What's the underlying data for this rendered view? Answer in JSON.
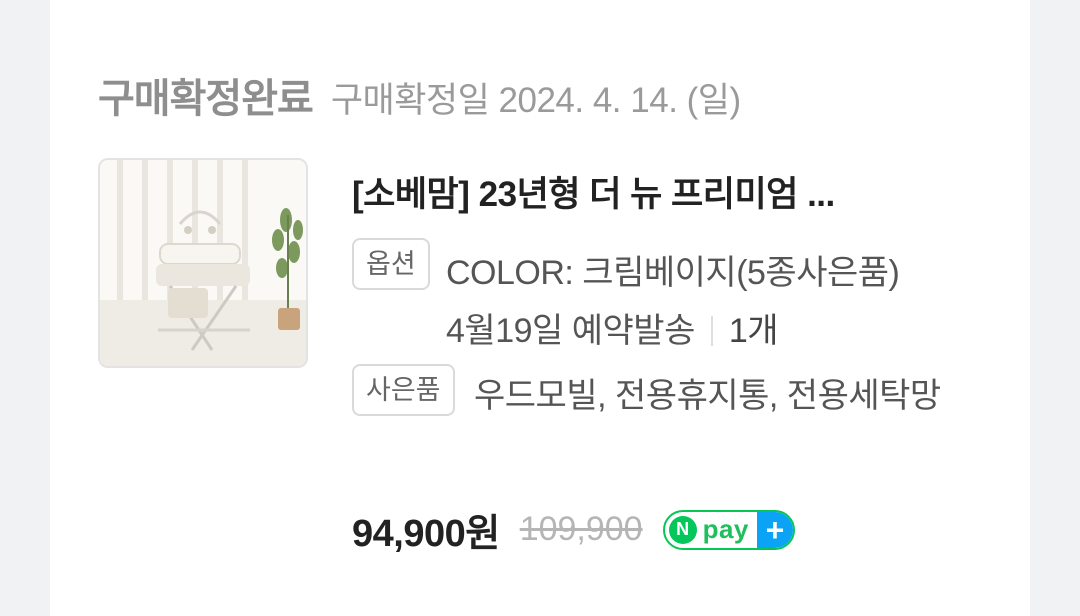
{
  "order": {
    "status": "구매확정완료",
    "date_label": "구매확정일 2024. 4. 14. (일)"
  },
  "product": {
    "title": "[소베맘] 23년형 더 뉴 프리미엄 ...",
    "image_alt": "baby changing table product photo",
    "option_tag": "옵션",
    "option_text": "COLOR: 크림베이지(5종사은품)",
    "delivery_text": "4월19일 예약발송",
    "quantity": "1개",
    "gift_tag": "사은품",
    "gift_text": "우드모빌, 전용휴지통, 전용세탁망"
  },
  "price": {
    "current": "94,900원",
    "original": "109,900"
  },
  "badge": {
    "logo_letter": "N",
    "text": "pay",
    "plus": "+",
    "green": "#03c75a",
    "blue": "#0aa3f5"
  }
}
